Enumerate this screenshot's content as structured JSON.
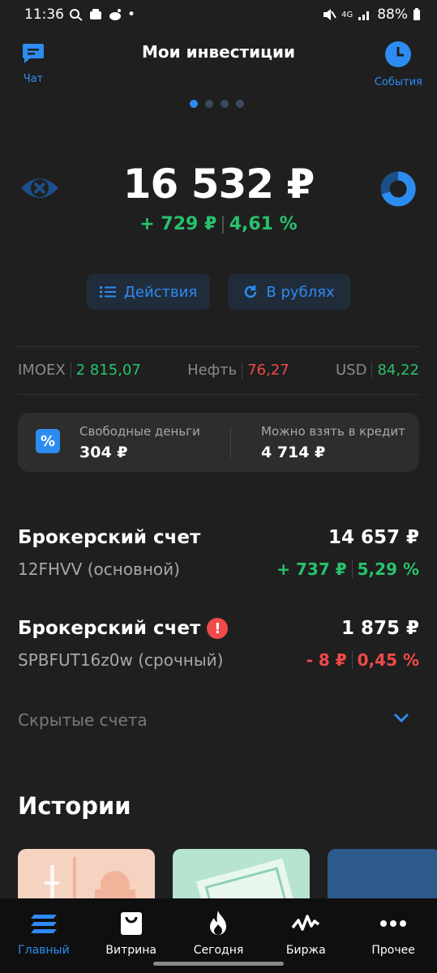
{
  "status_bar": {
    "time": "11:36",
    "battery": "88%",
    "network": "4G"
  },
  "header": {
    "title": "Мои инвестиции",
    "left_label": "Чат",
    "right_label": "События"
  },
  "pager": {
    "count": 4,
    "active": 0
  },
  "balance": {
    "total": "16 532 ₽",
    "change_abs": "+ 729 ₽",
    "change_pct": "4,61 %"
  },
  "actions": {
    "actions_label": "Действия",
    "currency_label": "В рублях"
  },
  "ticker": [
    {
      "name": "IMOEX",
      "value": "2 815,07",
      "color": "green"
    },
    {
      "name": "Нефть",
      "value": "76,27",
      "color": "red"
    },
    {
      "name": "USD",
      "value": "84,22",
      "color": "green"
    }
  ],
  "money": {
    "free_label": "Свободные деньги",
    "free_value": "304 ₽",
    "credit_label": "Можно взять в кредит",
    "credit_value": "4 714 ₽"
  },
  "accounts": [
    {
      "name": "Брокерский счет",
      "id": "12FHVV (основной)",
      "total": "14 657 ₽",
      "change_abs": "+ 737 ₽",
      "change_pct": "5,29 %",
      "color": "green",
      "warning": false
    },
    {
      "name": "Брокерский счет",
      "id": "SPBFUT16z0w (срочный)",
      "total": "1 875 ₽",
      "change_abs": "- 8 ₽",
      "change_pct": "0,45 %",
      "color": "red",
      "warning": true
    }
  ],
  "hidden_accounts_label": "Скрытые счета",
  "stories_title": "Истории",
  "nav": [
    {
      "label": "Главный",
      "icon": "home-stack-icon",
      "active": true
    },
    {
      "label": "Витрина",
      "icon": "shopping-bag-icon",
      "active": false
    },
    {
      "label": "Сегодня",
      "icon": "flame-icon",
      "active": false
    },
    {
      "label": "Биржа",
      "icon": "chart-line-icon",
      "active": false
    },
    {
      "label": "Прочее",
      "icon": "more-dots-icon",
      "active": false
    }
  ],
  "colors": {
    "accent": "#2d8cf0",
    "positive": "#27c26c",
    "negative": "#f04a4a",
    "background": "#1f1f1f"
  }
}
